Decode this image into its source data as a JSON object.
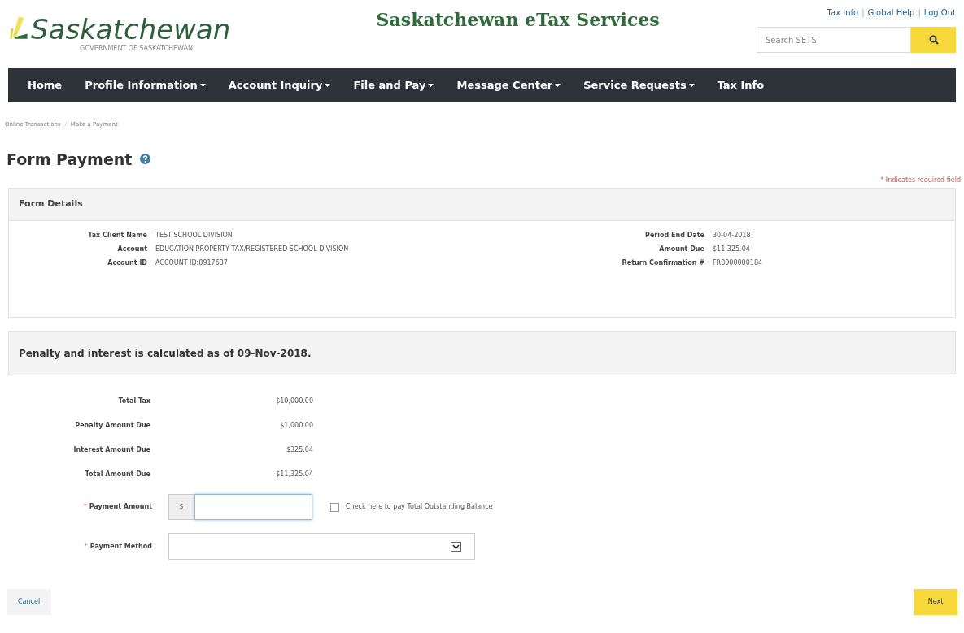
{
  "logo": {
    "name": "Saskatchewan",
    "subtitle": "GOVERNMENT OF SASKATCHEWAN"
  },
  "site_title": "Saskatchewan eTax Services",
  "top_links": [
    "Tax Info",
    "Global Help",
    "Log Out"
  ],
  "top_link_separator": "|",
  "breadcrumb_separator": "/",
  "search": {
    "placeholder": "Search SETS"
  },
  "nav": [
    {
      "label": "Home",
      "dropdown": false
    },
    {
      "label": "Profile Information",
      "dropdown": true
    },
    {
      "label": "Account Inquiry",
      "dropdown": true
    },
    {
      "label": "File and Pay",
      "dropdown": true
    },
    {
      "label": "Message Center",
      "dropdown": true
    },
    {
      "label": "Service Requests",
      "dropdown": true
    },
    {
      "label": "Tax Info",
      "dropdown": false
    }
  ],
  "breadcrumb": [
    "Online Transactions",
    "Make a Payment"
  ],
  "page_title": "Form Payment",
  "required_note": "* Indicates required field",
  "form_details": {
    "title": "Form Details",
    "left": [
      {
        "label": "Tax Client Name",
        "value": "TEST SCHOOL DIVISION"
      },
      {
        "label": "Account",
        "value": "EDUCATION PROPERTY TAX/REGISTERED SCHOOL DIVISION"
      },
      {
        "label": "Account ID",
        "value": "ACCOUNT ID:8917637"
      }
    ],
    "right": [
      {
        "label": "Period End Date",
        "value": "30-04-2018"
      },
      {
        "label": "Amount Due",
        "value": "$11,325.04"
      },
      {
        "label": "Return Confirmation #",
        "value": "FR0000000184"
      }
    ]
  },
  "penalty_notice": "Penalty and interest is calculated as of 09-Nov-2018.",
  "amounts": [
    {
      "label": "Total Tax",
      "value": "$10,000.00"
    },
    {
      "label": "Penalty Amount Due",
      "value": "$1,000.00"
    },
    {
      "label": "Interest Amount Due",
      "value": "$325.04"
    },
    {
      "label": "Total Amount Due",
      "value": "$11,325.04"
    }
  ],
  "payment_amount": {
    "label": "Payment Amount",
    "required_mark": "*",
    "prefix": "$",
    "checkbox_label": "Check here to pay Total Outstanding Balance",
    "checked": false
  },
  "payment_method": {
    "label": "Payment Method",
    "required_mark": "*"
  },
  "buttons": {
    "cancel": "Cancel",
    "next": "Next"
  }
}
